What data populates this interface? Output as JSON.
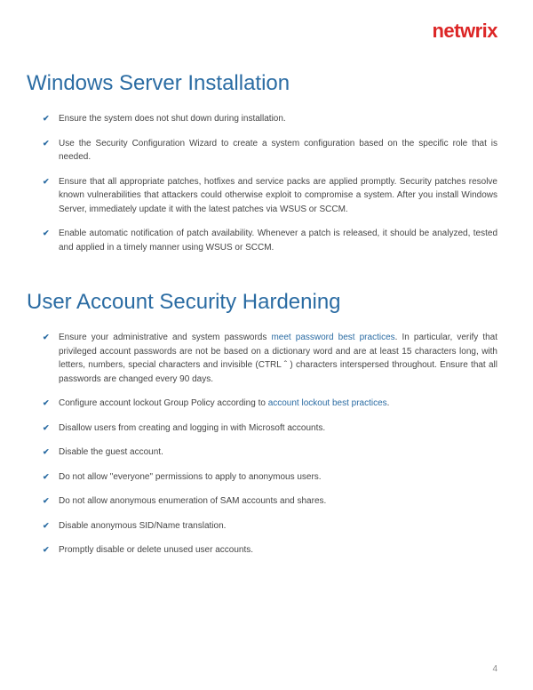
{
  "logo": "netwrix",
  "page_number": "4",
  "sections": [
    {
      "title": "Windows Server Installation",
      "items": [
        {
          "text": "Ensure the system does not shut down during installation."
        },
        {
          "text": "Use the Security Configuration Wizard to create a system configuration based on the specific role that is needed."
        },
        {
          "text": "Ensure that all appropriate patches, hotfixes and service packs are applied promptly. Security patches resolve known vulnerabilities that attackers could otherwise exploit to compromise a system. After you install Windows Server, immediately update it with the latest patches via WSUS or SCCM."
        },
        {
          "text": "Enable automatic notification of patch availability. Whenever a patch is released, it should be analyzed, tested and applied in a timely manner using WSUS or SCCM."
        }
      ]
    },
    {
      "title": "User Account Security Hardening",
      "items": [
        {
          "pre": "Ensure your administrative and system passwords ",
          "link": "meet password best practices",
          "post": ". In particular, verify that privileged account passwords are not be based on a dictionary word and are at least 15 characters long, with letters, numbers, special characters and invisible (CTRL ˆ ) characters interspersed throughout. Ensure that all passwords are changed every 90 days."
        },
        {
          "pre": "Configure account lockout Group Policy according to ",
          "link": "account lockout best practices",
          "post": "."
        },
        {
          "text": "Disallow users from creating and logging in with Microsoft accounts."
        },
        {
          "text": "Disable the guest account."
        },
        {
          "text": "Do not allow \"everyone\" permissions to apply to anonymous users."
        },
        {
          "text": "Do not allow anonymous enumeration of SAM accounts and shares."
        },
        {
          "text": "Disable anonymous SID/Name translation."
        },
        {
          "text": "Promptly disable or delete unused user accounts."
        }
      ]
    }
  ]
}
